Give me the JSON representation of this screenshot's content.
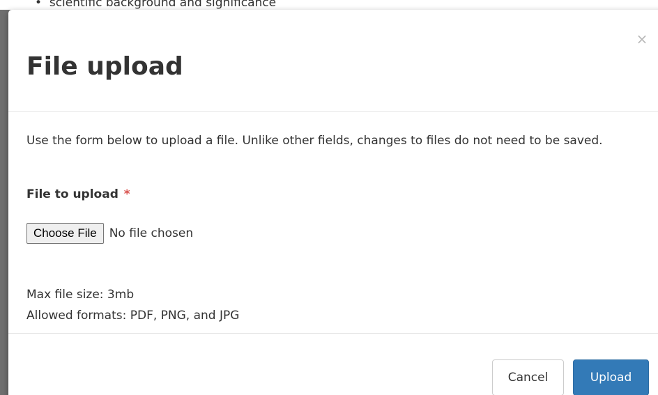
{
  "background": {
    "bullet_text": "scientific background and significance"
  },
  "modal": {
    "title": "File upload",
    "close_label": "×",
    "intro": "Use the form below to upload a file. Unlike other fields, changes to files do not need to be saved.",
    "field": {
      "label": "File to upload",
      "required_marker": "*",
      "choose_button_label": "Choose File",
      "status": "No file chosen"
    },
    "limits": {
      "max_size": "Max file size: 3mb",
      "allowed_formats": "Allowed formats: PDF, PNG, and JPG"
    },
    "footer": {
      "cancel_label": "Cancel",
      "upload_label": "Upload"
    }
  },
  "colors": {
    "primary": "#337ab7",
    "required": "#d9534f",
    "backdrop": "#6f6f6f"
  }
}
